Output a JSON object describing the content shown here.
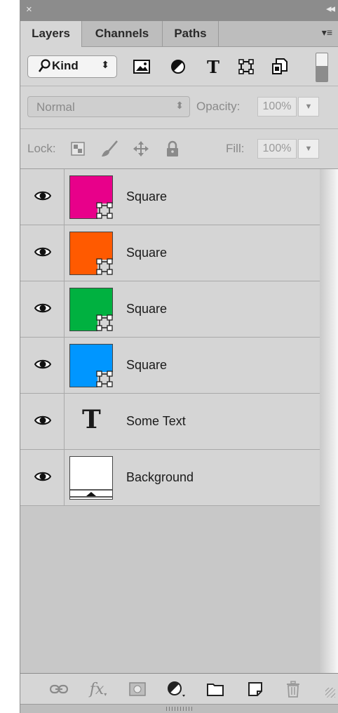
{
  "title_bar": {
    "close_glyph": "×",
    "collapse_glyph": "◂◂"
  },
  "tabs": [
    {
      "label": "Layers",
      "active": true
    },
    {
      "label": "Channels",
      "active": false
    },
    {
      "label": "Paths",
      "active": false
    }
  ],
  "panel_menu_glyph": "▾≡",
  "filter": {
    "kind_label": "Kind",
    "kind_arrows": "⬍",
    "icons": [
      "image-filter-icon",
      "adjustment-filter-icon",
      "type-filter-icon",
      "shape-filter-icon",
      "smart-object-filter-icon"
    ]
  },
  "blend": {
    "mode": "Normal",
    "mode_arrows": "⬍",
    "opacity_label": "Opacity:",
    "opacity_value": "100%"
  },
  "lock": {
    "label": "Lock:",
    "fill_label": "Fill:",
    "fill_value": "100%"
  },
  "layers": [
    {
      "name": "Square",
      "type": "shape",
      "color": "#e8008a",
      "visible": true
    },
    {
      "name": "Square",
      "type": "shape",
      "color": "#ff5a00",
      "visible": true
    },
    {
      "name": "Square",
      "type": "shape",
      "color": "#00b140",
      "visible": true
    },
    {
      "name": "Square",
      "type": "shape",
      "color": "#0096ff",
      "visible": true
    },
    {
      "name": "Some Text",
      "type": "text",
      "glyph": "T",
      "visible": true
    },
    {
      "name": "Background",
      "type": "background",
      "color": "#ffffff",
      "visible": true
    }
  ],
  "bottom_icons": [
    "link-layers-icon",
    "layer-style-fx-icon",
    "add-mask-icon",
    "new-adjustment-icon",
    "new-group-folder-icon",
    "new-layer-icon",
    "delete-layer-trash-icon"
  ],
  "fx_label": "fx",
  "colors": {
    "panel_bg": "#d6d6d6",
    "title_bar": "#8c8c8c",
    "list_bg": "#c8c8c8"
  }
}
